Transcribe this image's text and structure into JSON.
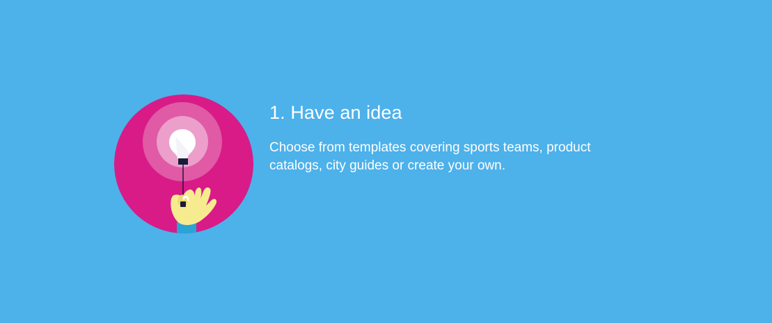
{
  "step": {
    "title": "1. Have an idea",
    "description": "Choose from templates covering sports teams, product catalogs, city guides or create your own."
  },
  "illustration": {
    "icon": "lightbulb-hand-icon"
  },
  "colors": {
    "background": "#4db1ea",
    "circle": "#d81b87",
    "glow_outer": "#e05aa6",
    "glow_inner": "#ec9fcb",
    "bulb": "#ffffff",
    "hand": "#f6ec8f",
    "sleeve": "#2aa3d6",
    "cord": "#1a1a3a",
    "text": "#ffffff"
  }
}
